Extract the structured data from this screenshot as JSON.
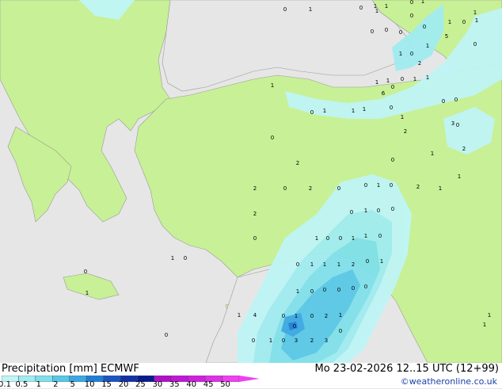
{
  "header": {
    "title": "Precipitation [mm]  ECMWF",
    "datetime": "Mo 23-02-2026 12..15 UTC (12+99)",
    "credit": "©weatheronline.co.uk"
  },
  "legend": {
    "ticks": [
      "0.1",
      "0.5",
      "1",
      "2",
      "5",
      "10",
      "15",
      "20",
      "25",
      "30",
      "35",
      "40",
      "45",
      "50"
    ],
    "colors": [
      "#bff5f5",
      "#a0ecf0",
      "#80e0ea",
      "#58c8e6",
      "#3aa8e2",
      "#1f7fd6",
      "#1a55c4",
      "#1233a8",
      "#0a1a90",
      "#b010c8",
      "#c018d8",
      "#d020e0",
      "#e030e8",
      "#f040f0"
    ]
  },
  "map": {
    "land_color": "#c8f096",
    "sea_color": "#e6e6e6",
    "values": [
      "0",
      "1",
      "0",
      "1",
      "1",
      "0",
      "1",
      "0",
      "0",
      "0",
      "0",
      "0",
      "1",
      "0",
      "1",
      "1",
      "0",
      "0",
      "1",
      "1",
      "1",
      "0",
      "1",
      "1",
      "0",
      "1",
      "1",
      "1",
      "0",
      "0",
      "0",
      "0",
      "2",
      "0",
      "0",
      "1",
      "2",
      "0",
      "2",
      "0",
      "0",
      "1",
      "0",
      "2",
      "0",
      "1",
      "0",
      "0",
      "0",
      "1",
      "0",
      "0",
      "1",
      "1",
      "0",
      "1",
      "0",
      "0",
      "1",
      "1",
      "1",
      "2",
      "0",
      "1",
      "1",
      "0",
      "0",
      "0",
      "0",
      "0",
      "1",
      "4",
      "0",
      "1",
      "0",
      "2",
      "1",
      "0",
      "0",
      "1",
      "0",
      "3",
      "2",
      "3",
      "1",
      "0",
      "1",
      "2",
      "1",
      "2",
      "0",
      "2",
      "3",
      "2",
      "1",
      "1",
      "6",
      "1",
      "5",
      "1",
      "1",
      "1",
      "0",
      "0"
    ]
  }
}
